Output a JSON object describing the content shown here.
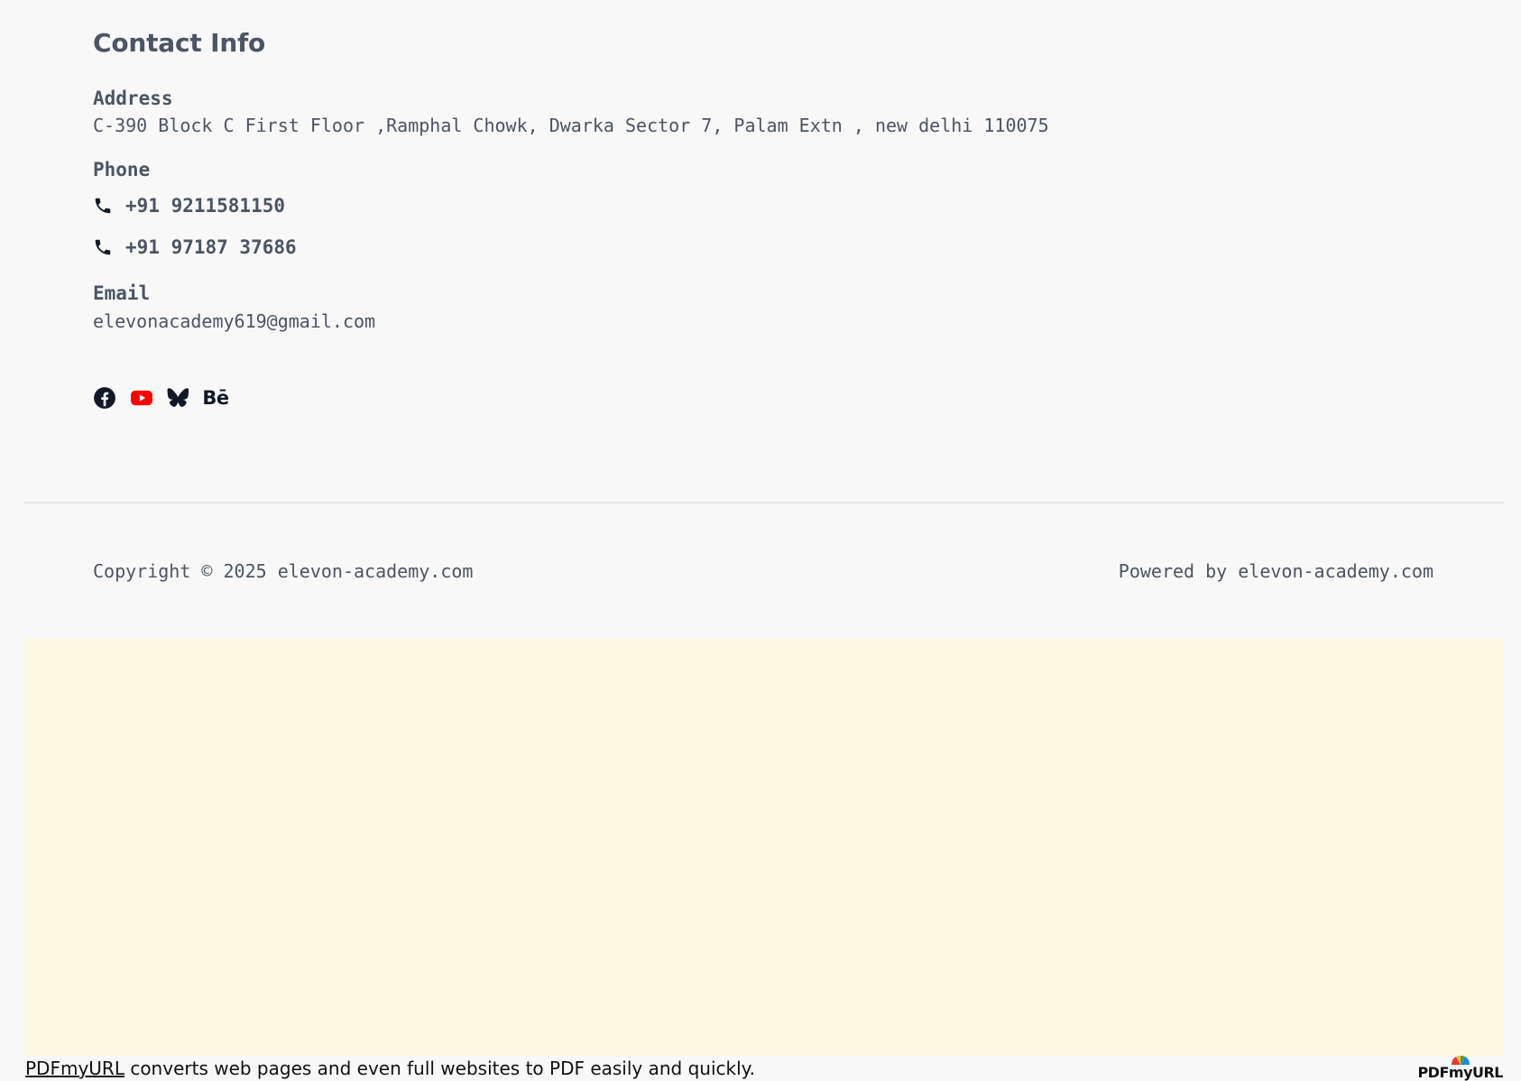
{
  "contact": {
    "title": "Contact Info",
    "address_label": "Address",
    "address": "C-390 Block C First Floor ,Ramphal Chowk, Dwarka Sector 7, Palam Extn , new delhi 110075",
    "phone_label": "Phone",
    "phones": [
      "+91 9211581150",
      "+91 97187 37686"
    ],
    "email_label": "Email",
    "email": "elevonacademy619@gmail.com"
  },
  "social": {
    "icons": [
      "facebook-icon",
      "youtube-icon",
      "bluesky-icon",
      "behance-icon"
    ],
    "behance_text": "Bē",
    "colors": {
      "facebook": "#111827",
      "youtube": "#ff0000",
      "bluesky": "#111827",
      "behance": "#111827"
    }
  },
  "footer": {
    "copyright": "Copyright © 2025 elevon-academy.com",
    "powered": "Powered by elevon-academy.com"
  },
  "pdf_note": {
    "link_text": "PDFmyURL",
    "text": " converts web pages and even full websites to PDF easily and quickly.",
    "logo_text": "PDFmyURL"
  },
  "colors": {
    "text": "#4b5563",
    "banner_bg": "#fef8e1",
    "divider": "#e5e7eb"
  }
}
